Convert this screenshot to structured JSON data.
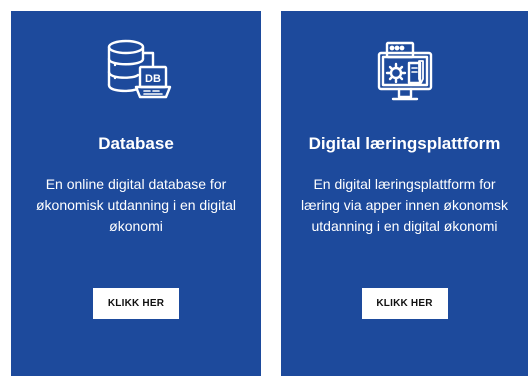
{
  "cards": [
    {
      "icon": "database-icon",
      "title": "Database",
      "description": "En online digital database for økonomisk utdanning i en digital økonomi",
      "button_label": "KLIKK HER"
    },
    {
      "icon": "learning-platform-monitor-icon",
      "title": "Digital læringsplattform",
      "description": "En digital læringsplattform for læring via apper innen økonomsk utdanning i en digital økonomi",
      "button_label": "KLIKK HER"
    }
  ],
  "colors": {
    "card_background": "#1d4a9c",
    "text": "#ffffff",
    "button_background": "#ffffff",
    "button_text": "#111111"
  }
}
